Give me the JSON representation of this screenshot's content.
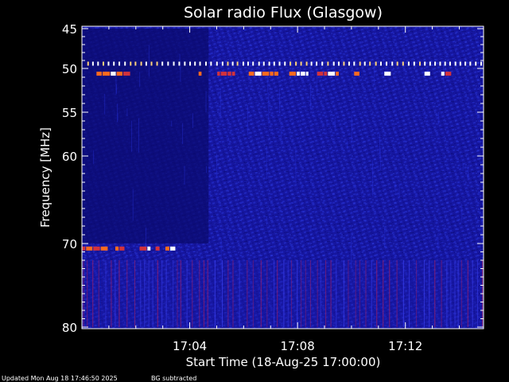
{
  "chart_data": {
    "type": "heatmap",
    "title": "Solar radio Flux (Glasgow)",
    "xlabel": "Start Time (18-Aug-25 17:00:00)",
    "ylabel": "Frequency [MHz]",
    "x_unit": "minutes after 17:00",
    "xlim": [
      0,
      14.9
    ],
    "x_ticks": [
      {
        "value": 4,
        "label": "17:04"
      },
      {
        "value": 8,
        "label": "17:08"
      },
      {
        "value": 12,
        "label": "17:12"
      }
    ],
    "ylim": [
      45,
      80
    ],
    "y_axis_direction": "increasing downward",
    "y_scale": "non-linear (compressed toward 70-80 MHz)",
    "y_ticks": [
      {
        "value": 45,
        "label": "45"
      },
      {
        "value": 50,
        "label": "50"
      },
      {
        "value": 55,
        "label": "55"
      },
      {
        "value": 60,
        "label": "60"
      },
      {
        "value": 70,
        "label": "70"
      },
      {
        "value": 80,
        "label": "80"
      }
    ],
    "colormap": [
      "#00002a",
      "#0a0a8c",
      "#1e28dc",
      "#b41e5a",
      "#ff5a1e",
      "#ffffff"
    ],
    "background_intensity": "low (blue) across the whole band",
    "features": [
      {
        "kind": "dashed constant-frequency interference",
        "frequency_mhz": 49.4,
        "x_start_min": 0.2,
        "x_end_min": 14.8,
        "intensity": "high",
        "note": "white/yellow dashes"
      },
      {
        "kind": "dashed constant-frequency interference",
        "frequency_mhz": 50.6,
        "x_start_min": 0.0,
        "x_end_min": 14.9,
        "intensity": "high",
        "note": "orange/white dashes, intermittent"
      },
      {
        "kind": "dashed constant-frequency interference",
        "frequency_mhz": 70.6,
        "x_start_min": 0.0,
        "x_end_min": 3.4,
        "intensity": "high",
        "note": "white/red dashes"
      },
      {
        "kind": "weak broadband vertical striations",
        "frequency_range_mhz": [
          72,
          80
        ],
        "x_start_min": 0.0,
        "x_end_min": 14.9,
        "intensity": "low-medium",
        "note": "faint red vertical streaks"
      },
      {
        "kind": "data gap / darker region",
        "frequency_range_mhz": [
          45,
          70
        ],
        "x_start_min": 0.0,
        "x_end_min": 4.7,
        "intensity": "very low"
      }
    ],
    "grid": false,
    "legend": "none"
  },
  "footer": {
    "updated": "Updated Mon Aug 18 17:46:50 2025",
    "processing": "BG subtracted"
  },
  "colors": {
    "background": "#000000",
    "text": "#ffffff",
    "axis": "#ffffff"
  }
}
